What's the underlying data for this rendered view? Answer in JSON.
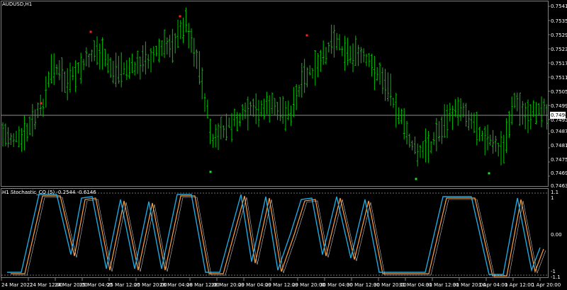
{
  "chart": {
    "symbol_title": "AUDUSD,H1",
    "current_price": "0.74943",
    "price_scale": [
      "0.75415",
      "0.75355",
      "0.75295",
      "0.75235",
      "0.75175",
      "0.75115",
      "0.75055",
      "0.74995",
      "0.74935",
      "0.74875",
      "0.74815",
      "0.74755",
      "0.74695",
      "0.74635"
    ],
    "time_scale": [
      "24 Mar 2022",
      "24 Mar 12:00",
      "24 Mar 20:00",
      "25 Mar 04:00",
      "25 Mar 12:00",
      "25 Mar 20:00",
      "28 Mar 04:00",
      "28 Mar 12:00",
      "28 Mar 20:00",
      "29 Mar 04:00",
      "29 Mar 12:00",
      "29 Mar 20:00",
      "30 Mar 04:00",
      "30 Mar 12:00",
      "30 Mar 20:00",
      "31 Mar 04:00",
      "31 Mar 12:00",
      "31 Mar 20:00",
      "1 Apr 04:00",
      "1 Apr 12:00",
      "1 Apr 20:00"
    ],
    "colors": {
      "background": "#000000",
      "bars": "#00c000",
      "grid_line": "#c0c0c0",
      "fractal_up": "#ff2020",
      "fractal_down": "#20e020",
      "stoch_main": "#1fa8e0",
      "stoch_signal": "#ffa040"
    }
  },
  "indicator": {
    "title": "H1 Stochastic_CO (5) -0.2544 -0.6146",
    "scale": [
      "1.1",
      "1",
      "0.00",
      "-1",
      "-1.1"
    ]
  }
}
